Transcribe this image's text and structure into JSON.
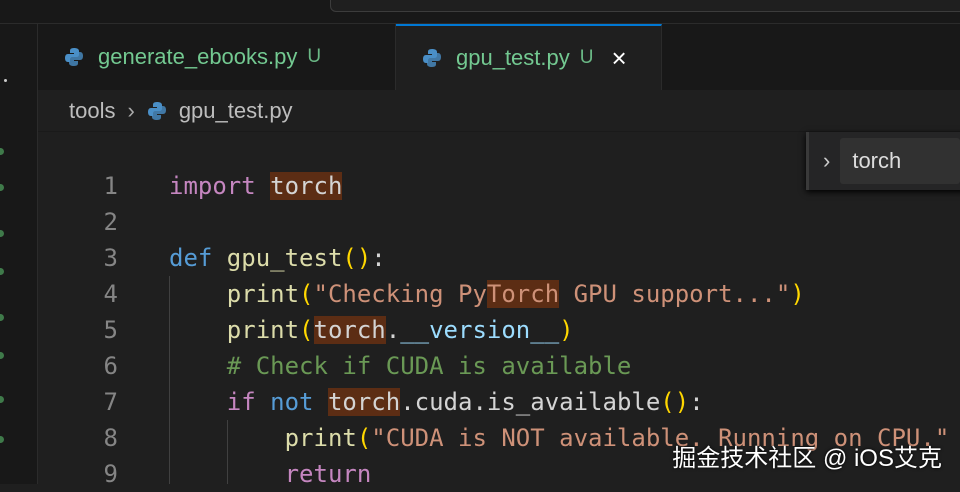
{
  "tabs": [
    {
      "label": "generate_ebooks.py",
      "status": "U",
      "active": false
    },
    {
      "label": "gpu_test.py",
      "status": "U",
      "active": true,
      "close": "×"
    }
  ],
  "breadcrumb": {
    "folder": "tools",
    "separator": "›",
    "file": "gpu_test.py"
  },
  "find": {
    "chevron": "›",
    "value": "torch"
  },
  "code": [
    {
      "n": "1",
      "tokens": [
        [
          "kw",
          "import "
        ],
        [
          "pl hl",
          "torch"
        ]
      ]
    },
    {
      "n": "2",
      "tokens": []
    },
    {
      "n": "3",
      "tokens": [
        [
          "def",
          "def "
        ],
        [
          "fn",
          "gpu_test"
        ],
        [
          "br",
          "()"
        ],
        [
          "pl",
          ":"
        ]
      ]
    },
    {
      "n": "4",
      "tokens": [
        [
          "pl",
          "    "
        ],
        [
          "fn",
          "print"
        ],
        [
          "br",
          "("
        ],
        [
          "str",
          "\"Checking Py"
        ],
        [
          "str hl",
          "Torch"
        ],
        [
          "str",
          " GPU support...\""
        ],
        [
          "br",
          ")"
        ]
      ]
    },
    {
      "n": "5",
      "tokens": [
        [
          "pl",
          "    "
        ],
        [
          "fn",
          "print"
        ],
        [
          "br",
          "("
        ],
        [
          "pl hl",
          "torch"
        ],
        [
          "pl",
          "."
        ],
        [
          "var",
          "__version__"
        ],
        [
          "br",
          ")"
        ]
      ]
    },
    {
      "n": "6",
      "tokens": [
        [
          "pl",
          "    "
        ],
        [
          "cm",
          "# Check if CUDA is available"
        ]
      ]
    },
    {
      "n": "7",
      "tokens": [
        [
          "pl",
          "    "
        ],
        [
          "kw",
          "if "
        ],
        [
          "def",
          "not "
        ],
        [
          "pl hl",
          "torch"
        ],
        [
          "pl",
          ".cuda.is_available"
        ],
        [
          "br",
          "()"
        ],
        [
          "pl",
          ":"
        ]
      ]
    },
    {
      "n": "8",
      "tokens": [
        [
          "pl",
          "        "
        ],
        [
          "fn",
          "print"
        ],
        [
          "br",
          "("
        ],
        [
          "str",
          "\"CUDA is NOT available. Running on CPU.\""
        ]
      ]
    },
    {
      "n": "9",
      "tokens": [
        [
          "pl",
          "        "
        ],
        [
          "kw",
          "return"
        ]
      ]
    }
  ],
  "watermark": "掘金技术社区 @ iOS艾克"
}
